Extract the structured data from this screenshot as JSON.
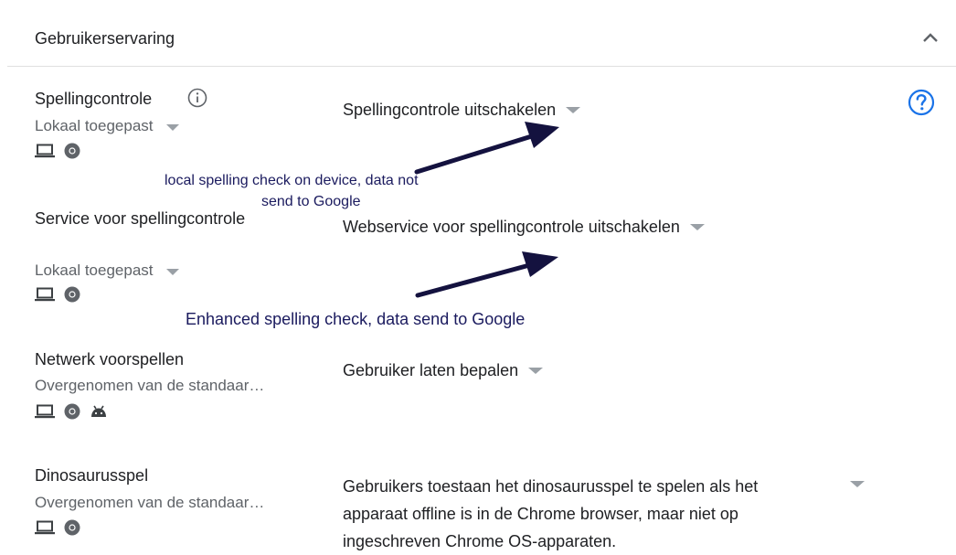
{
  "section": {
    "title": "Gebruikerservaring"
  },
  "settings": [
    {
      "name": "Spellingcontrole",
      "inherit": "Lokaal toegepast",
      "value": "Spellingcontrole uitschakelen",
      "icons": [
        "laptop-icon",
        "chrome-icon"
      ]
    },
    {
      "name": "Service voor spellingcontrole",
      "inherit": "Lokaal toegepast",
      "value": "Webservice voor spellingcontrole uitschakelen",
      "icons": [
        "laptop-icon",
        "chrome-icon"
      ]
    },
    {
      "name": "Netwerk voorspellen",
      "inherit": "Overgenomen van de standaar…",
      "value": "Gebruiker laten bepalen",
      "icons": [
        "laptop-icon",
        "chrome-icon",
        "android-icon"
      ]
    },
    {
      "name": "Dinosaurusspel",
      "inherit": "Overgenomen van de standaar…",
      "value_lines": [
        "Gebruikers toestaan het dinosaurusspel te spelen als het",
        "apparaat offline is in de Chrome browser, maar niet op",
        "ingeschreven Chrome OS-apparaten."
      ],
      "icons": [
        "laptop-icon",
        "chrome-icon"
      ]
    }
  ],
  "annotations": {
    "first_line1": "local spelling check on device, data not",
    "first_line2": "send to Google",
    "second": "Enhanced spelling check, data send to Google"
  },
  "colors": {
    "accent": "#1a73e8",
    "annotation": "#1a1a5e",
    "caret": "#9aa0a6",
    "secondary_text": "#5f6368"
  }
}
